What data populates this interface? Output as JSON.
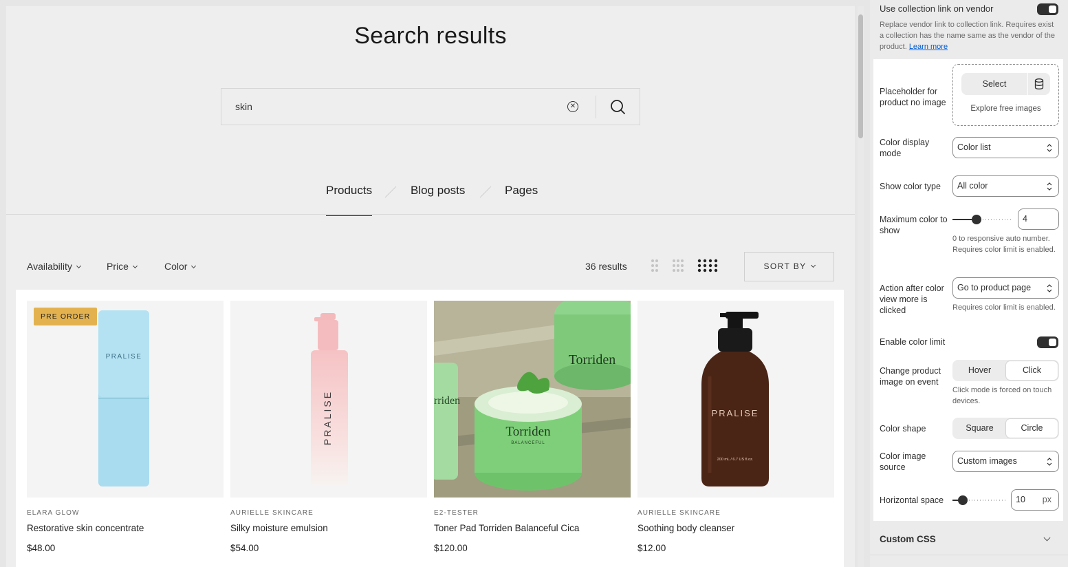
{
  "preview": {
    "title": "Search results",
    "search": {
      "value": "skin"
    },
    "tabs": [
      {
        "label": "Products",
        "active": true
      },
      {
        "label": "Blog posts",
        "active": false
      },
      {
        "label": "Pages",
        "active": false
      }
    ],
    "filters": [
      "Availability",
      "Price",
      "Color"
    ],
    "results_count": "36 results",
    "sort_label": "SORT BY",
    "products": [
      {
        "vendor": "ELARA GLOW",
        "name": "Restorative skin concentrate",
        "price": "$48.00",
        "badge": "PRE ORDER",
        "label": "PRALISE"
      },
      {
        "vendor": "AURIELLE SKINCARE",
        "name": "Silky moisture emulsion",
        "price": "$54.00",
        "badge": "",
        "label": "PRALISE"
      },
      {
        "vendor": "E2-TESTER",
        "name": "Toner Pad Torriden Balanceful Cica",
        "price": "$120.00",
        "badge": "",
        "label": "Torriden",
        "sublabel": "BALANCEFUL"
      },
      {
        "vendor": "AURIELLE SKINCARE",
        "name": "Soothing body cleanser",
        "price": "$12.00",
        "badge": "",
        "label": "PRALISE",
        "sublabel": "200 mL / 6.7 US fl.oz."
      }
    ]
  },
  "sidebar": {
    "vendor_link": {
      "label": "Use collection link on vendor",
      "help": "Replace vendor link to collection link. Requires exist a collection has the name same as the vendor of the product.",
      "learn_more": "Learn more",
      "enabled": true
    },
    "placeholder": {
      "label": "Placeholder for product no image",
      "select": "Select",
      "explore": "Explore free images"
    },
    "color_display_mode": {
      "label": "Color display mode",
      "value": "Color list"
    },
    "show_color_type": {
      "label": "Show color type",
      "value": "All color"
    },
    "max_color": {
      "label": "Maximum color to show",
      "value": "4",
      "help": "0 to responsive auto number. Requires color limit is enabled.",
      "fraction": 0.4
    },
    "action_after": {
      "label": "Action after color view more is clicked",
      "value": "Go to product page",
      "help": "Requires color limit is enabled."
    },
    "enable_color_limit": {
      "label": "Enable color limit",
      "enabled": true
    },
    "change_image": {
      "label": "Change product image on event",
      "options": [
        "Hover",
        "Click"
      ],
      "selected": "Click",
      "help": "Click mode is forced on touch devices."
    },
    "color_shape": {
      "label": "Color shape",
      "options": [
        "Square",
        "Circle"
      ],
      "selected": "Circle"
    },
    "color_image_source": {
      "label": "Color image source",
      "value": "Custom images"
    },
    "horizontal_space": {
      "label": "Horizontal space",
      "value": "10",
      "unit": "px",
      "fraction": 0.2
    },
    "custom_css": "Custom CSS"
  },
  "colors": {
    "badge": "#e3b24f",
    "toggle": "#303030",
    "link": "#005bd3"
  }
}
